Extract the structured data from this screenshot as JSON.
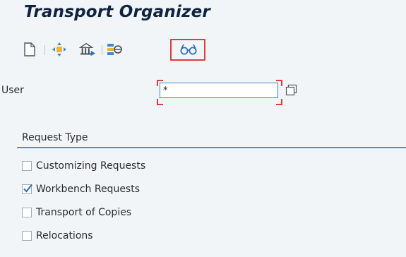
{
  "app": {
    "title": "Transport Organizer"
  },
  "toolbar": {
    "items": [
      {
        "name": "create-icon"
      },
      {
        "name": "move-icon"
      },
      {
        "name": "transport-building-icon"
      },
      {
        "name": "transport-tools-icon"
      },
      {
        "name": "display-glasses-icon"
      }
    ],
    "highlighted": "display-glasses-icon"
  },
  "user_field": {
    "label": "User",
    "value": "*"
  },
  "request_type": {
    "title": "Request Type",
    "options": [
      {
        "label": "Customizing Requests",
        "checked": false
      },
      {
        "label": "Workbench Requests",
        "checked": true
      },
      {
        "label": "Transport of Copies",
        "checked": false
      },
      {
        "label": "Relocations",
        "checked": false
      }
    ]
  },
  "colors": {
    "accent_blue": "#4a8fd2",
    "highlight_red": "#e23b3b",
    "title_navy": "#0f2340",
    "checkmark_blue": "#2f6fb6"
  }
}
